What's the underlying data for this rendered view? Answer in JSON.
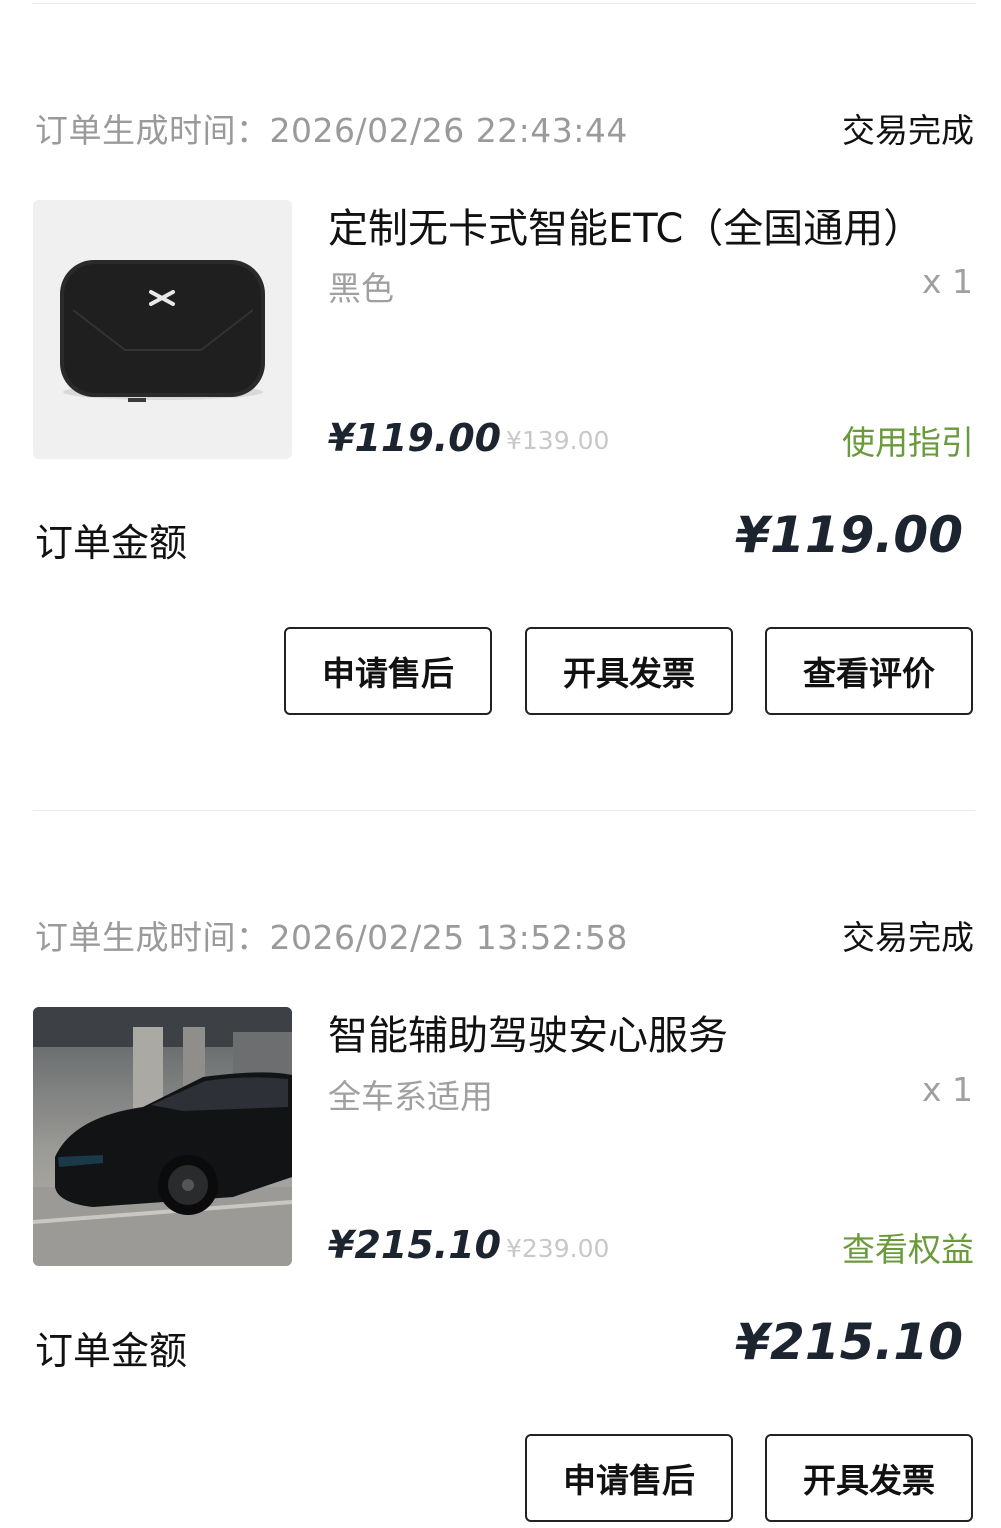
{
  "orders": [
    {
      "created_label": "订单生成时间：",
      "created_time": "2026/02/26 22:43:44",
      "status": "交易完成",
      "product_title": "定制无卡式智能ETC（全国通用）",
      "variant": "黑色",
      "quantity": "x 1",
      "price": "¥119.00",
      "original_price": "¥139.00",
      "link_label": "使用指引",
      "amount_label": "订单金额",
      "amount": "¥119.00",
      "buttons": [
        "申请售后",
        "开具发票",
        "查看评价"
      ],
      "image_icon": "etc-device-image"
    },
    {
      "created_label": "订单生成时间：",
      "created_time": "2026/02/25 13:52:58",
      "status": "交易完成",
      "product_title": "智能辅助驾驶安心服务",
      "variant": "全车系适用",
      "quantity": "x 1",
      "price": "¥215.10",
      "original_price": "¥239.00",
      "link_label": "查看权益",
      "amount_label": "订单金额",
      "amount": "¥215.10",
      "buttons": [
        "申请售后",
        "开具发票"
      ],
      "image_icon": "black-suv-image"
    }
  ],
  "colors": {
    "link_green": "#6a9a3c",
    "price_dark": "#1c2430",
    "muted_gray": "#9a9a9a"
  }
}
